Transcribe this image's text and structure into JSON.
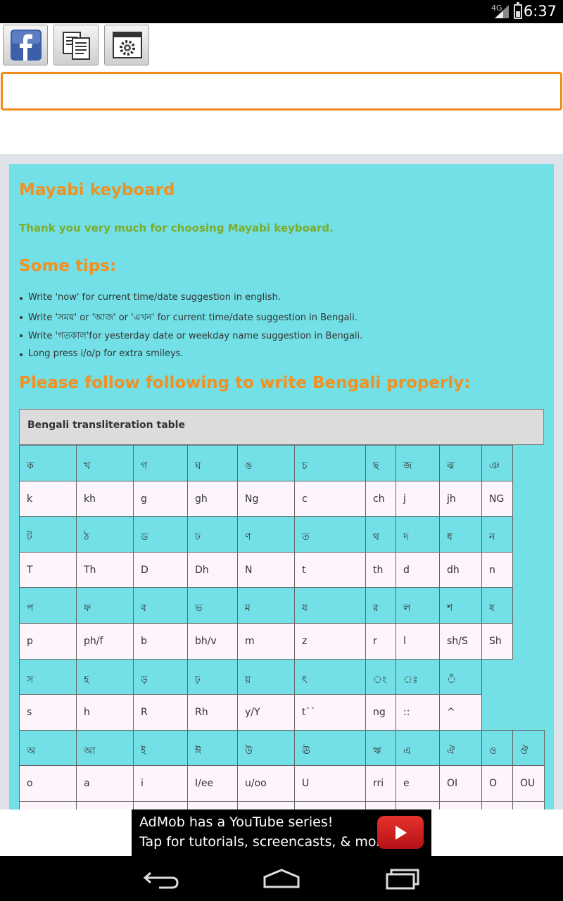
{
  "status_bar": {
    "network": "4G",
    "time": "6:37"
  },
  "toolbar": {
    "buttons": [
      {
        "name": "facebook-button",
        "icon": "facebook-icon"
      },
      {
        "name": "copy-button",
        "icon": "copy-icon"
      },
      {
        "name": "settings-button",
        "icon": "settings-icon"
      }
    ]
  },
  "input": {
    "value": "",
    "placeholder": ""
  },
  "content": {
    "title": "Mayabi keyboard",
    "thanks": "Thank you very much for choosing Mayabi keyboard.",
    "tips_heading": "Some tips:",
    "tips": [
      "Write 'now' for current time/date suggestion in english.",
      "Write 'সময়' or 'আজ' or 'এখন' for current time/date suggestion in Bengali.",
      "Write 'গতকাল'for yesterday date or weekday name suggestion in Bengali.",
      "Long press i/o/p for extra smileys."
    ],
    "follow_heading": "Please follow following to write Bengali properly:",
    "table_caption": "Bengali transliteration table",
    "table_rows": [
      [
        "ক",
        "খ",
        "গ",
        "ঘ",
        "ঙ",
        "চ",
        "ছ",
        "জ",
        "ঝ",
        "ঞ"
      ],
      [
        "k",
        "kh",
        "g",
        "gh",
        "Ng",
        "c",
        "ch",
        "j",
        "jh",
        "NG"
      ],
      [
        "ট",
        "ঠ",
        "ড",
        "ঢ",
        "ণ",
        "ত",
        "থ",
        "দ",
        "ধ",
        "ন"
      ],
      [
        "T",
        "Th",
        "D",
        "Dh",
        "N",
        "t",
        "th",
        "d",
        "dh",
        "n"
      ],
      [
        "প",
        "ফ",
        "ব",
        "ভ",
        "ম",
        "য",
        "র",
        "ল",
        "শ",
        "ষ"
      ],
      [
        "p",
        "ph/f",
        "b",
        "bh/v",
        "m",
        "z",
        "r",
        "l",
        "sh/S",
        "Sh"
      ],
      [
        "স",
        "হ",
        "ড়",
        "ঢ়",
        "য়",
        "ৎ",
        "ং",
        "ঃ",
        "ঁ"
      ],
      [
        "s",
        "h",
        "R",
        "Rh",
        "y/Y",
        "t``",
        "ng",
        "::",
        "^"
      ],
      [
        "অ",
        "আ",
        "ই",
        "ঈ",
        "উ",
        "ঊ",
        "ঋ",
        "এ",
        "ঐ",
        "ও",
        "ঔ"
      ],
      [
        "o",
        "a",
        "i",
        "I/ee",
        "u/oo",
        "U",
        "rri",
        "e",
        "OI",
        "O",
        "OU"
      ],
      [
        "",
        "",
        "",
        "",
        "",
        "",
        "",
        "",
        "",
        "",
        ""
      ]
    ]
  },
  "ad": {
    "line1": "AdMob has a YouTube series!",
    "line2": "Tap for tutorials, screencasts, & more.",
    "icon": "youtube-play-icon"
  },
  "nav": {
    "back": "back-icon",
    "home": "home-icon",
    "recents": "recents-icon"
  }
}
